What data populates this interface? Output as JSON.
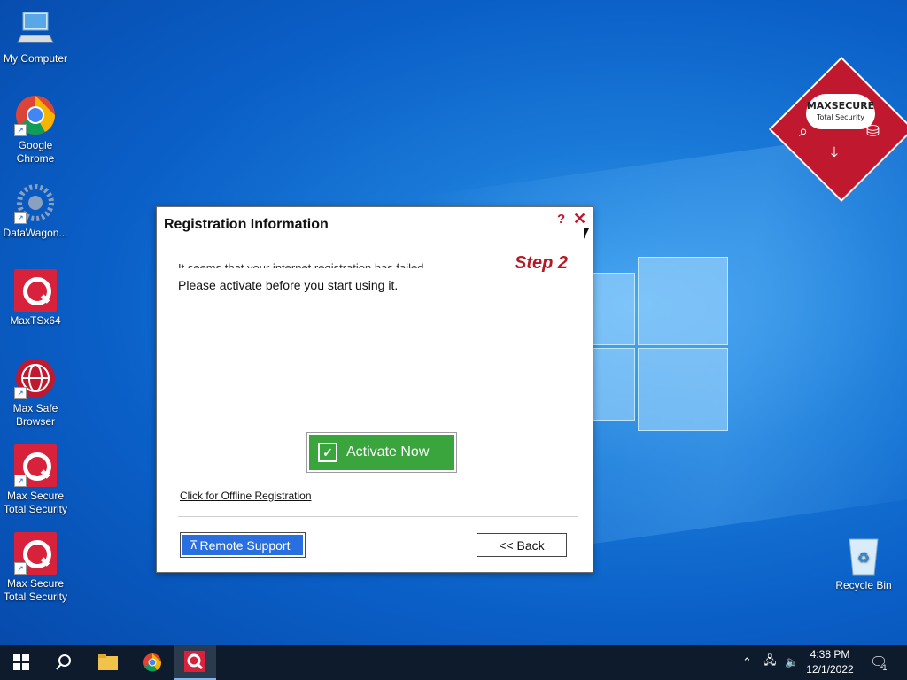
{
  "desktop": {
    "icons": [
      {
        "label": "My Computer"
      },
      {
        "label": "Google Chrome"
      },
      {
        "label": "DataWagon..."
      },
      {
        "label": "MaxTSx64"
      },
      {
        "label": "Max Safe Browser"
      },
      {
        "label": "Max Secure Total Security"
      },
      {
        "label": "Max Secure Total Security"
      },
      {
        "label": "Recycle Bin"
      }
    ],
    "widget": {
      "brand": "MAXSECURE",
      "subtitle": "Total Security"
    }
  },
  "dialog": {
    "title": "Registration Information",
    "help": "?",
    "close": "✕",
    "step": "Step 2",
    "message_partial": "It seems that your internet registration has failed.",
    "message": "Please activate before you start using it.",
    "activate_label": "Activate Now",
    "offline_link": "Click for Offline Registration",
    "remote_label": "Remote Support",
    "back_label": "<< Back"
  },
  "taskbar": {
    "time": "4:38 PM",
    "date": "12/1/2022",
    "notification_count": "1"
  },
  "colors": {
    "accent": "#c0182f",
    "activate": "#3aa53d",
    "remote": "#2a6fe0"
  }
}
